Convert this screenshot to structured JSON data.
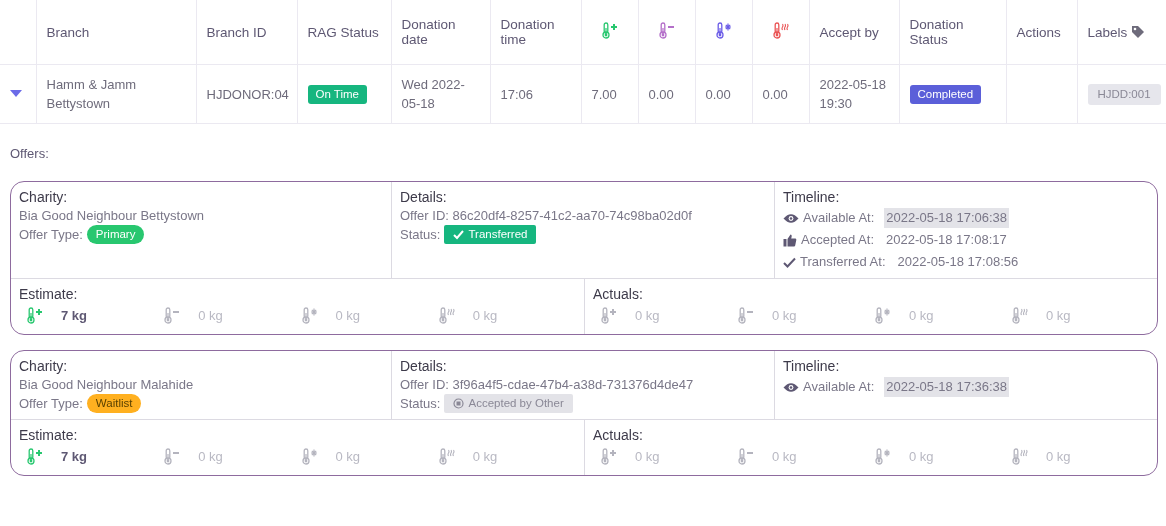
{
  "table": {
    "columns": [
      {
        "kind": "blank"
      },
      {
        "kind": "text",
        "label": "Branch"
      },
      {
        "kind": "text",
        "label": "Branch ID"
      },
      {
        "kind": "text",
        "label": "RAG Status"
      },
      {
        "kind": "text",
        "label": "Donation date"
      },
      {
        "kind": "text",
        "label": "Donation time"
      },
      {
        "kind": "chilled"
      },
      {
        "kind": "ambient"
      },
      {
        "kind": "frozen"
      },
      {
        "kind": "hot"
      },
      {
        "kind": "text",
        "label": "Accept by"
      },
      {
        "kind": "text",
        "label": "Donation Status"
      },
      {
        "kind": "text",
        "label": "Actions"
      },
      {
        "kind": "tag",
        "label": "Labels"
      }
    ],
    "rows": [
      {
        "expanded": true,
        "branch": "Hamm & Jamm Bettystown",
        "branch_id": "HJDONOR:04",
        "rag_status": "On Time",
        "donation_date": "Wed 2022-05-18",
        "donation_time": "17:06",
        "chilled": "7.00",
        "ambient": "0.00",
        "frozen": "0.00",
        "hot": "0.00",
        "accept_by": "2022-05-18 19:30",
        "donation_status": "Completed",
        "label": "HJDD:001"
      }
    ]
  },
  "offers_title": "Offers:",
  "offers": [
    {
      "charity_heading": "Charity:",
      "charity": "Bia Good Neighbour Bettystown",
      "offer_type_label": "Offer Type:",
      "offer_type": {
        "kind": "primary",
        "label": "Primary"
      },
      "details_heading": "Details:",
      "offer_id": "Offer ID: 86c20df4-8257-41c2-aa70-74c98ba02d0f",
      "status_label": "Status:",
      "status": {
        "kind": "transferred",
        "label": "Transferred"
      },
      "timeline_heading": "Timeline:",
      "timeline": [
        {
          "kind": "available",
          "label": "Available At:",
          "time": "2022-05-18 17:06:38",
          "highlighted": true
        },
        {
          "kind": "accepted",
          "label": "Accepted At:",
          "time": "2022-05-18 17:08:17",
          "highlighted": false
        },
        {
          "kind": "transferred",
          "label": "Transferred At:",
          "time": "2022-05-18 17:08:56",
          "highlighted": false
        }
      ],
      "estimate_heading": "Estimate:",
      "estimate": [
        {
          "kind": "chilled",
          "amount": "7 kg",
          "active": true
        },
        {
          "kind": "ambient",
          "amount": "0 kg",
          "active": false
        },
        {
          "kind": "frozen",
          "amount": "0 kg",
          "active": false
        },
        {
          "kind": "hot",
          "amount": "0 kg",
          "active": false
        }
      ],
      "actuals_heading": "Actuals:",
      "actuals": [
        {
          "kind": "chilled",
          "amount": "0 kg",
          "active": false
        },
        {
          "kind": "ambient",
          "amount": "0 kg",
          "active": false
        },
        {
          "kind": "frozen",
          "amount": "0 kg",
          "active": false
        },
        {
          "kind": "hot",
          "amount": "0 kg",
          "active": false
        }
      ]
    },
    {
      "charity_heading": "Charity:",
      "charity": "Bia Good Neighbour Malahide",
      "offer_type_label": "Offer Type:",
      "offer_type": {
        "kind": "waitlist",
        "label": "Waitlist"
      },
      "details_heading": "Details:",
      "offer_id": "Offer ID: 3f96a4f5-cdae-47b4-a38d-731376d4de47",
      "status_label": "Status:",
      "status": {
        "kind": "accepted_other",
        "label": "Accepted by Other"
      },
      "timeline_heading": "Timeline:",
      "timeline": [
        {
          "kind": "available",
          "label": "Available At:",
          "time": "2022-05-18 17:36:38",
          "highlighted": true
        }
      ],
      "estimate_heading": "Estimate:",
      "estimate": [
        {
          "kind": "chilled",
          "amount": "7 kg",
          "active": true
        },
        {
          "kind": "ambient",
          "amount": "0 kg",
          "active": false
        },
        {
          "kind": "frozen",
          "amount": "0 kg",
          "active": false
        },
        {
          "kind": "hot",
          "amount": "0 kg",
          "active": false
        }
      ],
      "actuals_heading": "Actuals:",
      "actuals": [
        {
          "kind": "chilled",
          "amount": "0 kg",
          "active": false
        },
        {
          "kind": "ambient",
          "amount": "0 kg",
          "active": false
        },
        {
          "kind": "frozen",
          "amount": "0 kg",
          "active": false
        },
        {
          "kind": "hot",
          "amount": "0 kg",
          "active": false
        }
      ]
    }
  ]
}
